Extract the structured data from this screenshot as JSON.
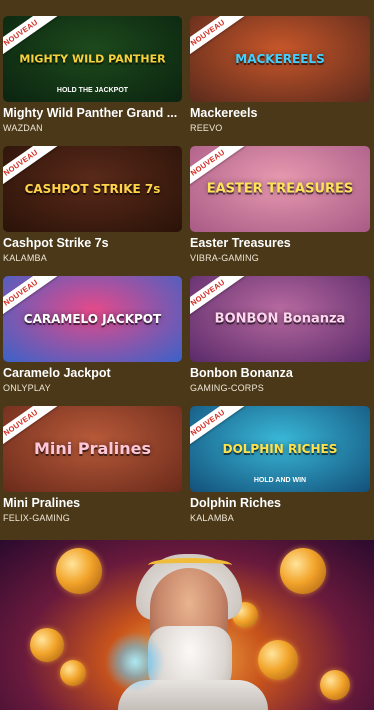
{
  "badge_label": "NOUVEAU",
  "games": [
    {
      "name": "Mighty Wild Panther Grand ...",
      "provider": "WAZDAN",
      "art_text": "MIGHTY WILD PANTHER",
      "art_sub": "HOLD THE JACKPOT",
      "bg": "#1d4a1c",
      "bg2": "#0b2410",
      "accent": "#f7d23a",
      "new": true
    },
    {
      "name": "Mackereels",
      "provider": "REEVO",
      "art_text": "MACKEREELS",
      "art_sub": "",
      "bg": "#c9572a",
      "bg2": "#5a2a1c",
      "accent": "#3fd0ff",
      "new": true
    },
    {
      "name": "Cashpot Strike 7s",
      "provider": "KALAMBA",
      "art_text": "CASHPOT STRIKE 7s",
      "art_sub": "",
      "bg": "#5a2a1a",
      "bg2": "#2a1208",
      "accent": "#ffd34a",
      "new": true
    },
    {
      "name": "Easter Treasures",
      "provider": "VIBRA-GAMING",
      "art_text": "EASTER TREASURES",
      "art_sub": "",
      "bg": "#e89ab0",
      "bg2": "#a85a86",
      "accent": "#ffe45a",
      "new": true
    },
    {
      "name": "Caramelo Jackpot",
      "provider": "ONLYPLAY",
      "art_text": "CARAMELO JACKPOT",
      "art_sub": "",
      "bg": "#e54a8a",
      "bg2": "#3a62c8",
      "accent": "#ffffff",
      "new": true
    },
    {
      "name": "Bonbon Bonanza",
      "provider": "GAMING-CORPS",
      "art_text": "BONBON Bonanza",
      "art_sub": "",
      "bg": "#b86aa0",
      "bg2": "#5a2a6a",
      "accent": "#ffd6f0",
      "new": true
    },
    {
      "name": "Mini Pralines",
      "provider": "FELIX-GAMING",
      "art_text": "Mini Pralines",
      "art_sub": "",
      "bg": "#b85a3a",
      "bg2": "#6a2a1a",
      "accent": "#ffc6d8",
      "new": true
    },
    {
      "name": "Dolphin Riches",
      "provider": "KALAMBA",
      "art_text": "DOLPHIN RICHES",
      "art_sub": "HOLD AND WIN",
      "bg": "#3ab8d8",
      "bg2": "#12507a",
      "accent": "#ffe24a",
      "new": true
    }
  ],
  "colors": {
    "page_bg": "#4a3818",
    "ribbon_bg": "#ffffff",
    "ribbon_text": "#d12a1f"
  }
}
